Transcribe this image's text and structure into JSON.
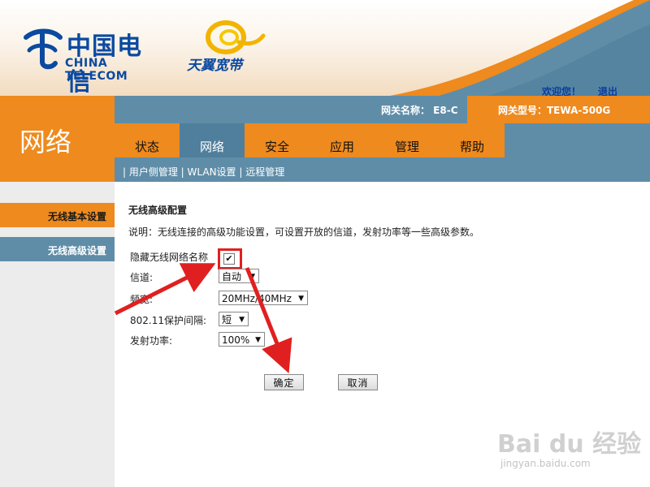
{
  "header": {
    "logo_cn": "中国电信",
    "logo_en": "CHINA TELECOM",
    "brand2": "天翼宽带",
    "welcome": "欢迎您！",
    "logout": "退出"
  },
  "section_title": "网络",
  "gateway": {
    "name": "网关名称：  E8-C",
    "model": "网关型号：TEWA-500G"
  },
  "tabs": [
    {
      "label": "状态"
    },
    {
      "label": "网络"
    },
    {
      "label": "安全"
    },
    {
      "label": "应用"
    },
    {
      "label": "管理"
    },
    {
      "label": "帮助"
    }
  ],
  "active_tab": "网络",
  "subnav": "| 用户侧管理 | WLAN设置 | 远程管理",
  "sidebar": {
    "items": [
      {
        "label": "无线基本设置"
      },
      {
        "label": "无线高级设置"
      }
    ]
  },
  "form": {
    "title": "无线高级配置",
    "description": "说明：无线连接的高级功能设置，可设置开放的信道，发射功率等一些高级参数。",
    "hide_ssid_label": "隐藏无线网络名称",
    "hide_ssid_checked": true,
    "channel_label": "信道:",
    "channel_value": "自动",
    "bandwidth_label": "频宽:",
    "bandwidth_value": "20MHz/40MHz",
    "guard_label": "802.11保护间隔:",
    "guard_value": "短",
    "power_label": "发射功率:",
    "power_value": "100%",
    "ok_label": "确定",
    "cancel_label": "取消"
  },
  "watermark": {
    "text": "Bai du 经验",
    "sub": "jingyan.baidu.com"
  },
  "colors": {
    "orange": "#ee8a1e",
    "blue": "#5f8da8",
    "brand_blue": "#0b4aa0",
    "annotation_red": "#e02020"
  }
}
